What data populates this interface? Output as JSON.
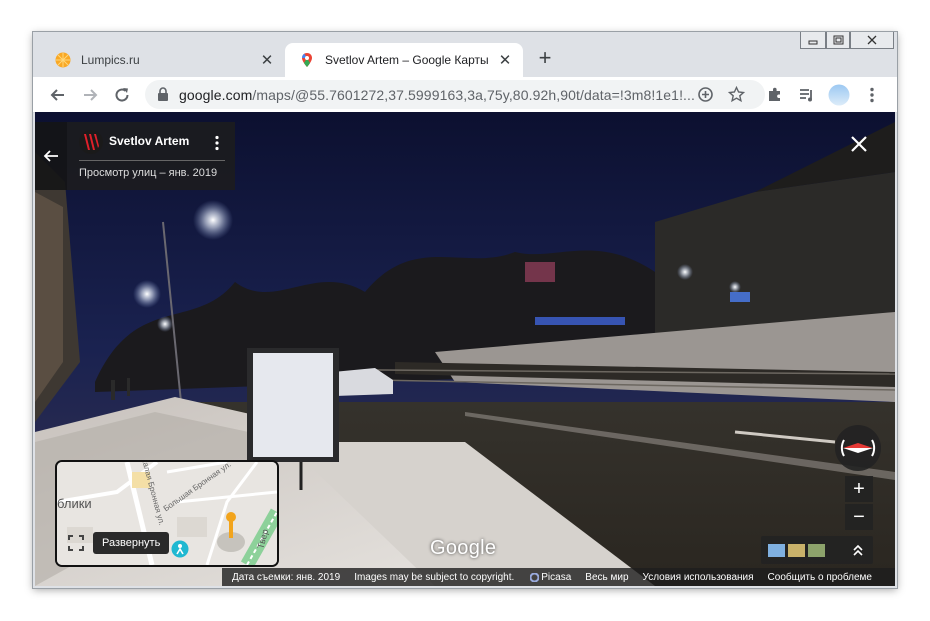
{
  "browser": {
    "tabs": [
      {
        "title": "Lumpics.ru",
        "active": false,
        "favicon": "lumpics-orange-icon"
      },
      {
        "title": "Svetlov Artem – Google Карты",
        "active": true,
        "favicon": "google-maps-pin-icon"
      }
    ],
    "new_tab": "+",
    "url_host": "google.com",
    "url_path": "/maps/@55.7601272,37.5999163,3a,75y,80.92h,90t/data=!3m8!1e1!..."
  },
  "streetview": {
    "author": "Svetlov Artem",
    "subtitle": "Просмотр улиц – янв. 2019",
    "expand_tooltip": "Развернуть",
    "google_mark": "Google",
    "map_labels": {
      "bliki": "блики",
      "bronnaya1": "Малая Бронная ул.",
      "bronnaya2": "Большая Бронная ул.",
      "tver": "Твер"
    },
    "footer": [
      "Дата съемки: янв. 2019",
      "Images may be subject to copyright.",
      "Picasa",
      "Весь мир",
      "Условия использования",
      "Сообщить о проблеме"
    ],
    "zoom_in": "+",
    "zoom_out": "−"
  },
  "colors": {
    "tab_bar": "#dee1e6",
    "maps_red": "#ea4335",
    "lumpics_orange": "#f9a825"
  }
}
